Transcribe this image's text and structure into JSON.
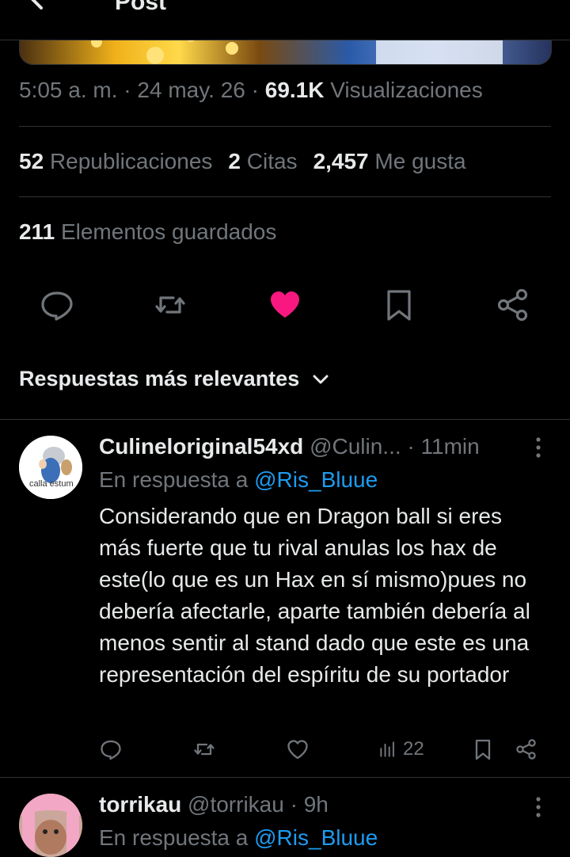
{
  "header": {
    "title": "Post",
    "back_icon": "arrow-left-icon"
  },
  "post": {
    "time": "5:05 a. m.",
    "date": "24 may. 26",
    "views_count": "69.1K",
    "views_label": "Visualizaciones",
    "reposts_count": "52",
    "reposts_label": "Republicaciones",
    "quotes_count": "2",
    "quotes_label": "Citas",
    "likes_count": "2,457",
    "likes_label": "Me gusta",
    "bookmarks_count": "211",
    "bookmarks_label": "Elementos guardados",
    "liked": true,
    "like_color": "#f91880"
  },
  "sort": {
    "label": "Respuestas más relevantes"
  },
  "replies": [
    {
      "display_name": "Culineloriginal54xd",
      "handle": "@Culin...",
      "time": "· 11min",
      "reply_prefix": "En respuesta a",
      "reply_to": "@Ris_Bluue",
      "text": "Considerando que en Dragon ball si eres más fuerte que tu rival anulas los hax de este(lo que es un Hax en sí mismo)pues no debería afectarle, aparte también debería al menos sentir al stand dado que este es una representación del espíritu de su portador",
      "views": "22",
      "avatar_text": "calla estum"
    },
    {
      "display_name": "torrikau",
      "handle": "@torrikau",
      "time": "· 9h",
      "reply_prefix": "En respuesta a",
      "reply_to": "@Ris_Bluue"
    }
  ],
  "colors": {
    "background": "#000000",
    "text": "#e7e9ea",
    "muted": "#71767b",
    "link": "#1d9bf0",
    "divider": "#2f3336"
  }
}
